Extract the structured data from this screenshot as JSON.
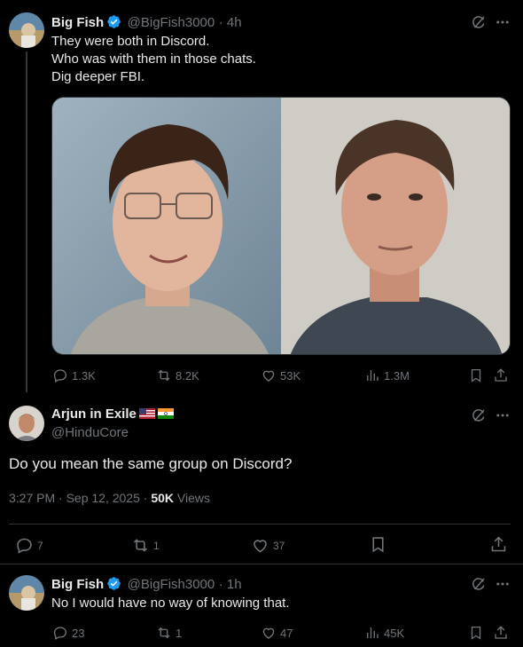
{
  "post1": {
    "author": "Big Fish",
    "handle": "@BigFish3000",
    "time": "· 4h",
    "lines": [
      "They were both in Discord.",
      "Who was with them in those chats.",
      "Dig deeper FBI."
    ],
    "replies": "1.3K",
    "reposts": "8.2K",
    "likes": "53K",
    "views": "1.3M"
  },
  "post2": {
    "author": "Arjun in Exile",
    "handle": "@HinduCore",
    "text": "Do you mean the same group on Discord?",
    "timestamp": "3:27 PM · Sep 12, 2025 · ",
    "views_count": "50K",
    "views_label": " Views",
    "replies": "7",
    "reposts": "1",
    "likes": "37"
  },
  "post3": {
    "author": "Big Fish",
    "handle": "@BigFish3000",
    "time": "· 1h",
    "text": "No I would have no way of knowing that.",
    "replies": "23",
    "reposts": "1",
    "likes": "47",
    "views": "45K"
  },
  "colors": {
    "background": "#000000",
    "text": "#e7e9ea",
    "muted": "#71767b",
    "verified": "#1d9bf0",
    "divider": "#2f3336"
  },
  "icons": [
    "grok-icon",
    "more-icon",
    "reply-icon",
    "repost-icon",
    "like-icon",
    "views-icon",
    "bookmark-icon",
    "share-icon",
    "verified-badge-icon",
    "us-flag-icon",
    "india-flag-icon"
  ]
}
